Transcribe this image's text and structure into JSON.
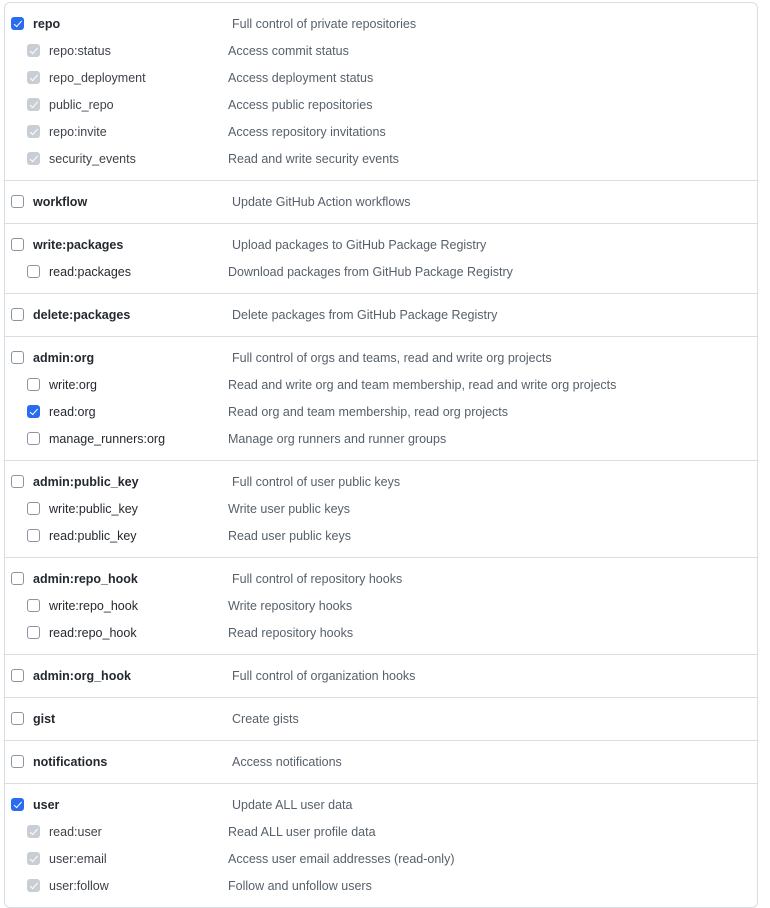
{
  "panel": {
    "name": "oauth-scopes-selector",
    "colors": {
      "checked_blue": "#2a6cf0",
      "disabled_gray": "#c9ced4",
      "border": "#d8dee4",
      "label_text": "#24292f",
      "desc_text": "#57606a"
    }
  },
  "groups": [
    {
      "rows": [
        {
          "level": "parent",
          "label": "repo",
          "description": "Full control of private repositories",
          "state": "checked"
        },
        {
          "level": "child",
          "label": "repo:status",
          "description": "Access commit status",
          "state": "disabled-checked"
        },
        {
          "level": "child",
          "label": "repo_deployment",
          "description": "Access deployment status",
          "state": "disabled-checked"
        },
        {
          "level": "child",
          "label": "public_repo",
          "description": "Access public repositories",
          "state": "disabled-checked"
        },
        {
          "level": "child",
          "label": "repo:invite",
          "description": "Access repository invitations",
          "state": "disabled-checked"
        },
        {
          "level": "child",
          "label": "security_events",
          "description": "Read and write security events",
          "state": "disabled-checked"
        }
      ]
    },
    {
      "rows": [
        {
          "level": "parent",
          "label": "workflow",
          "description": "Update GitHub Action workflows",
          "state": "unchecked"
        }
      ]
    },
    {
      "rows": [
        {
          "level": "parent",
          "label": "write:packages",
          "description": "Upload packages to GitHub Package Registry",
          "state": "unchecked"
        },
        {
          "level": "child",
          "label": "read:packages",
          "description": "Download packages from GitHub Package Registry",
          "state": "unchecked"
        }
      ]
    },
    {
      "rows": [
        {
          "level": "parent",
          "label": "delete:packages",
          "description": "Delete packages from GitHub Package Registry",
          "state": "unchecked"
        }
      ]
    },
    {
      "rows": [
        {
          "level": "parent",
          "label": "admin:org",
          "description": "Full control of orgs and teams, read and write org projects",
          "state": "unchecked"
        },
        {
          "level": "child",
          "label": "write:org",
          "description": "Read and write org and team membership, read and write org projects",
          "state": "unchecked"
        },
        {
          "level": "child",
          "label": "read:org",
          "description": "Read org and team membership, read org projects",
          "state": "checked"
        },
        {
          "level": "child",
          "label": "manage_runners:org",
          "description": "Manage org runners and runner groups",
          "state": "unchecked"
        }
      ]
    },
    {
      "rows": [
        {
          "level": "parent",
          "label": "admin:public_key",
          "description": "Full control of user public keys",
          "state": "unchecked"
        },
        {
          "level": "child",
          "label": "write:public_key",
          "description": "Write user public keys",
          "state": "unchecked"
        },
        {
          "level": "child",
          "label": "read:public_key",
          "description": "Read user public keys",
          "state": "unchecked"
        }
      ]
    },
    {
      "rows": [
        {
          "level": "parent",
          "label": "admin:repo_hook",
          "description": "Full control of repository hooks",
          "state": "unchecked"
        },
        {
          "level": "child",
          "label": "write:repo_hook",
          "description": "Write repository hooks",
          "state": "unchecked"
        },
        {
          "level": "child",
          "label": "read:repo_hook",
          "description": "Read repository hooks",
          "state": "unchecked"
        }
      ]
    },
    {
      "rows": [
        {
          "level": "parent",
          "label": "admin:org_hook",
          "description": "Full control of organization hooks",
          "state": "unchecked"
        }
      ]
    },
    {
      "rows": [
        {
          "level": "parent",
          "label": "gist",
          "description": "Create gists",
          "state": "unchecked"
        }
      ]
    },
    {
      "rows": [
        {
          "level": "parent",
          "label": "notifications",
          "description": "Access notifications",
          "state": "unchecked"
        }
      ]
    },
    {
      "rows": [
        {
          "level": "parent",
          "label": "user",
          "description": "Update ALL user data",
          "state": "checked"
        },
        {
          "level": "child",
          "label": "read:user",
          "description": "Read ALL user profile data",
          "state": "disabled-checked"
        },
        {
          "level": "child",
          "label": "user:email",
          "description": "Access user email addresses (read-only)",
          "state": "disabled-checked"
        },
        {
          "level": "child",
          "label": "user:follow",
          "description": "Follow and unfollow users",
          "state": "disabled-checked"
        }
      ]
    }
  ]
}
